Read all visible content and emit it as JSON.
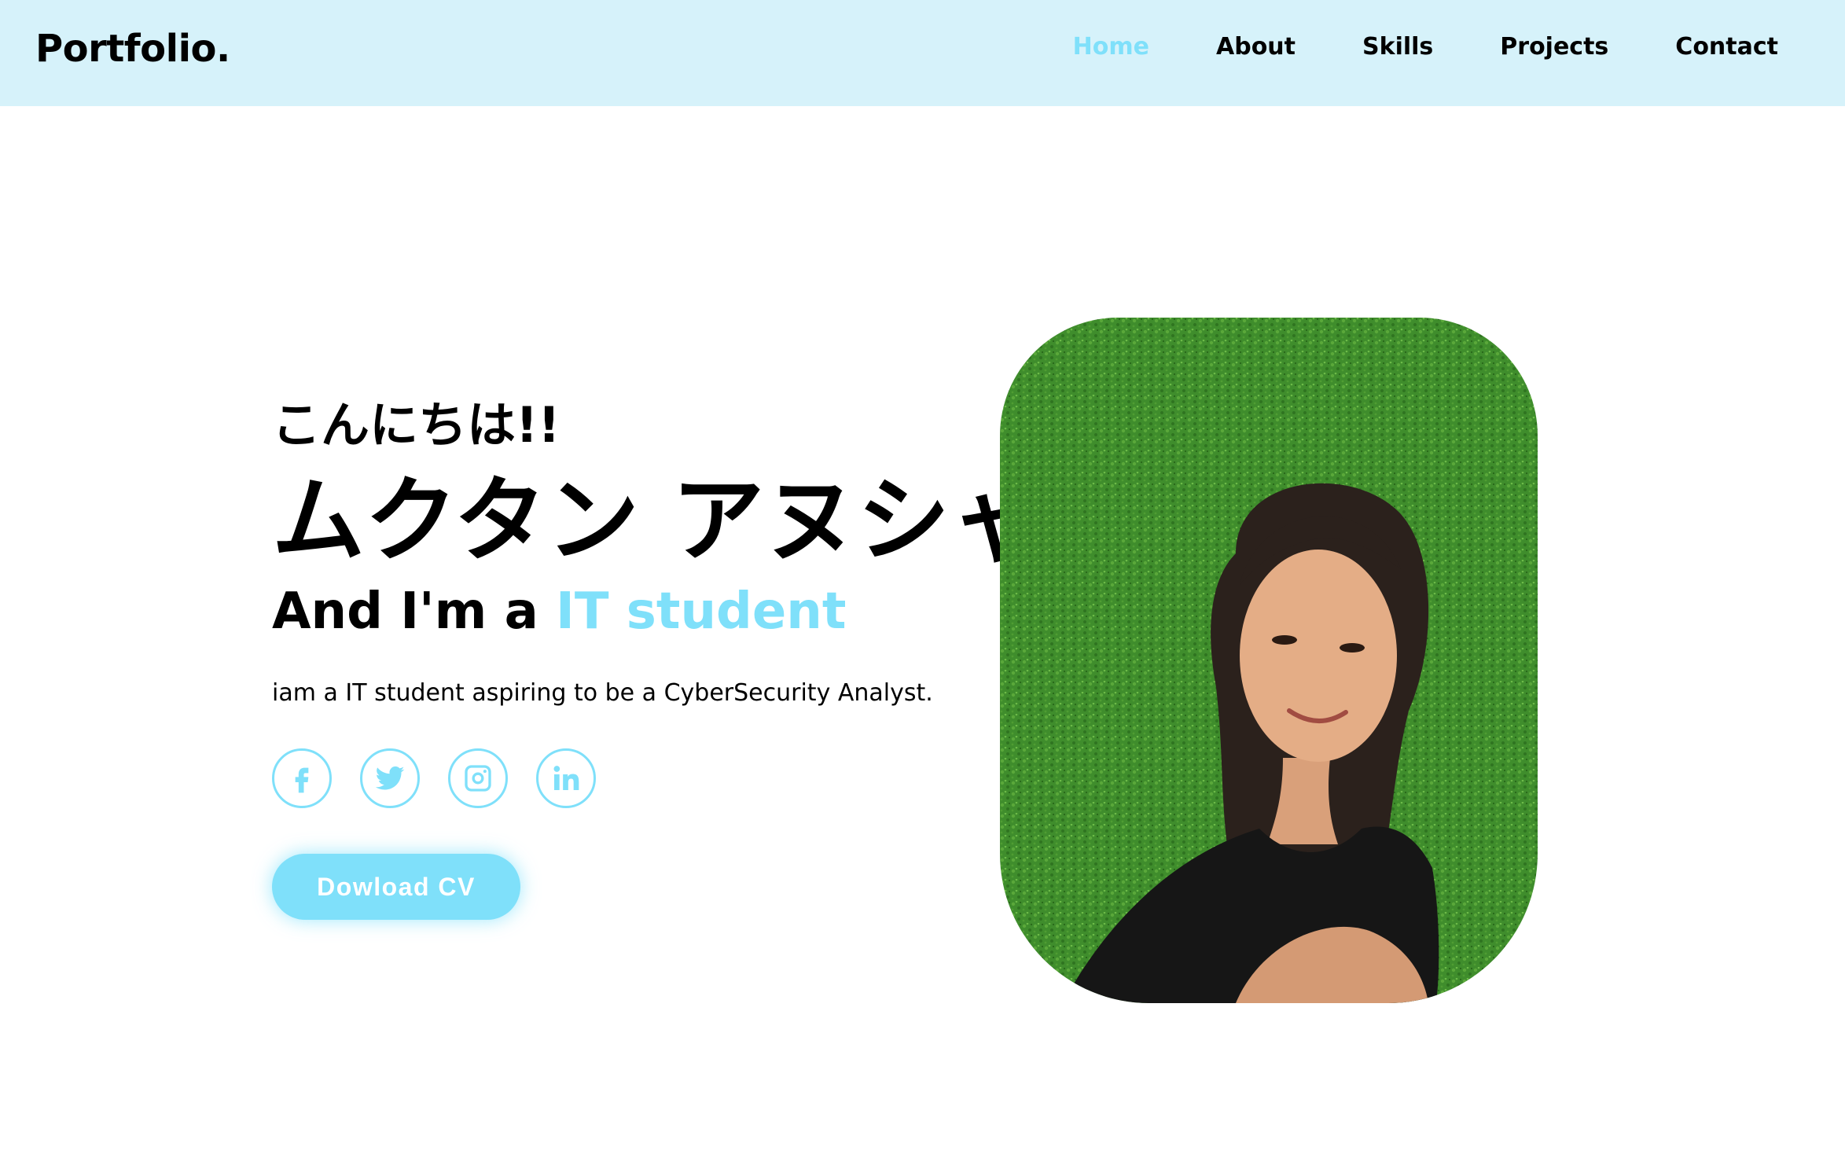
{
  "header": {
    "logo": "Portfolio.",
    "nav": [
      {
        "label": "Home",
        "active": true
      },
      {
        "label": "About",
        "active": false
      },
      {
        "label": "Skills",
        "active": false
      },
      {
        "label": "Projects",
        "active": false
      },
      {
        "label": "Contact",
        "active": false
      }
    ]
  },
  "hero": {
    "greeting": "こんにちは!!",
    "name": "ムクタン アヌシャ",
    "role_prefix": "And I'm a ",
    "role_highlight": "IT student",
    "description": "iam a IT student aspiring to be a CyberSecurity Analyst.",
    "socials": [
      {
        "icon": "facebook-icon"
      },
      {
        "icon": "twitter-icon"
      },
      {
        "icon": "instagram-icon"
      },
      {
        "icon": "linkedin-icon"
      }
    ],
    "cv_button": "Dowload CV"
  },
  "colors": {
    "accent": "#7fe0fa",
    "header_bg": "#d6f2fa",
    "text": "#000000"
  }
}
